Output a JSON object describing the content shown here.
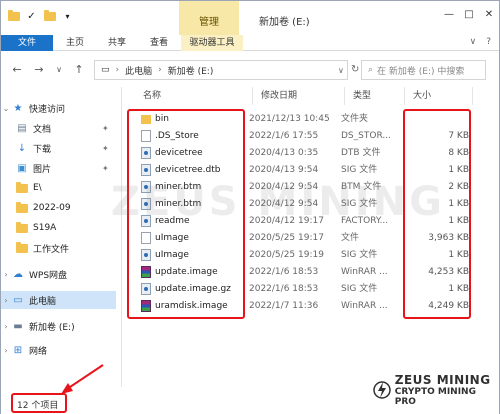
{
  "title_bar": {
    "context_tab": "管理",
    "window_title": "新加卷 (E:)",
    "controls": [
      "—",
      "□",
      "✕"
    ]
  },
  "ribbon": {
    "tabs": [
      "文件",
      "主页",
      "共享",
      "查看",
      "驱动器工具"
    ],
    "right": [
      "∨",
      "?"
    ]
  },
  "address": {
    "path": [
      "此电脑",
      "新加卷 (E:)"
    ],
    "search_placeholder": "在 新加卷 (E:) 中搜索"
  },
  "sidebar": {
    "items": [
      {
        "label": "快速访问",
        "icon": "star-icon",
        "pinned": false
      },
      {
        "label": "文档",
        "icon": "document-icon",
        "pinned": true
      },
      {
        "label": "下载",
        "icon": "download-icon",
        "pinned": true
      },
      {
        "label": "图片",
        "icon": "picture-icon",
        "pinned": true
      },
      {
        "label": "E\\",
        "icon": "folder-icon",
        "pinned": false
      },
      {
        "label": "2022-09",
        "icon": "folder-icon",
        "pinned": false
      },
      {
        "label": "S19A",
        "icon": "folder-icon",
        "pinned": false
      },
      {
        "label": "工作文件",
        "icon": "folder-icon",
        "pinned": false
      },
      {
        "label": "WPS网盘",
        "icon": "cloud-icon",
        "pinned": false
      },
      {
        "label": "此电脑",
        "icon": "computer-icon",
        "pinned": false
      },
      {
        "label": "新加卷 (E:)",
        "icon": "drive-icon",
        "pinned": false
      },
      {
        "label": "网络",
        "icon": "network-icon",
        "pinned": false
      }
    ]
  },
  "columns": {
    "name": "名称",
    "date": "修改日期",
    "type": "类型",
    "size": "大小"
  },
  "files": [
    {
      "name": "bin",
      "date": "2021/12/13 10:45",
      "type": "文件夹",
      "size": "",
      "icon": "folder"
    },
    {
      "name": ".DS_Store",
      "date": "2022/1/6 17:55",
      "type": "DS_STOR...",
      "size": "7 KB",
      "icon": "doc"
    },
    {
      "name": "devicetree",
      "date": "2020/4/13 0:35",
      "type": "DTB 文件",
      "size": "8 KB",
      "icon": "sig"
    },
    {
      "name": "devicetree.dtb",
      "date": "2020/4/13 9:54",
      "type": "SIG 文件",
      "size": "1 KB",
      "icon": "sig"
    },
    {
      "name": "miner.btm",
      "date": "2020/4/12 9:54",
      "type": "BTM 文件",
      "size": "2 KB",
      "icon": "sig"
    },
    {
      "name": "miner.btm",
      "date": "2020/4/12 9:54",
      "type": "SIG 文件",
      "size": "1 KB",
      "icon": "sig"
    },
    {
      "name": "readme",
      "date": "2020/4/12 19:17",
      "type": "FACTORY...",
      "size": "1 KB",
      "icon": "sig"
    },
    {
      "name": "uImage",
      "date": "2020/5/25 19:17",
      "type": "文件",
      "size": "3,963 KB",
      "icon": "doc"
    },
    {
      "name": "uImage",
      "date": "2020/5/25 19:19",
      "type": "SIG 文件",
      "size": "1 KB",
      "icon": "sig"
    },
    {
      "name": "update.image",
      "date": "2022/1/6 18:53",
      "type": "WinRAR ...",
      "size": "4,253 KB",
      "icon": "rar"
    },
    {
      "name": "update.image.gz",
      "date": "2022/1/6 18:53",
      "type": "SIG 文件",
      "size": "1 KB",
      "icon": "sig"
    },
    {
      "name": "uramdisk.image",
      "date": "2022/1/7 11:36",
      "type": "WinRAR ...",
      "size": "4,249 KB",
      "icon": "rar"
    }
  ],
  "status": {
    "count_text": "12 个项目"
  },
  "branding": {
    "watermark": "ZEUS MINING",
    "logo_line1": "ZEUS MINING",
    "logo_line2": "CRYPTO MINING PRO"
  },
  "colors": {
    "accent": "#1a73c9",
    "annotation": "#e8141b",
    "context_tab": "#f7e8a8",
    "selected": "#cfe4f8",
    "folder": "#f2c14e"
  }
}
